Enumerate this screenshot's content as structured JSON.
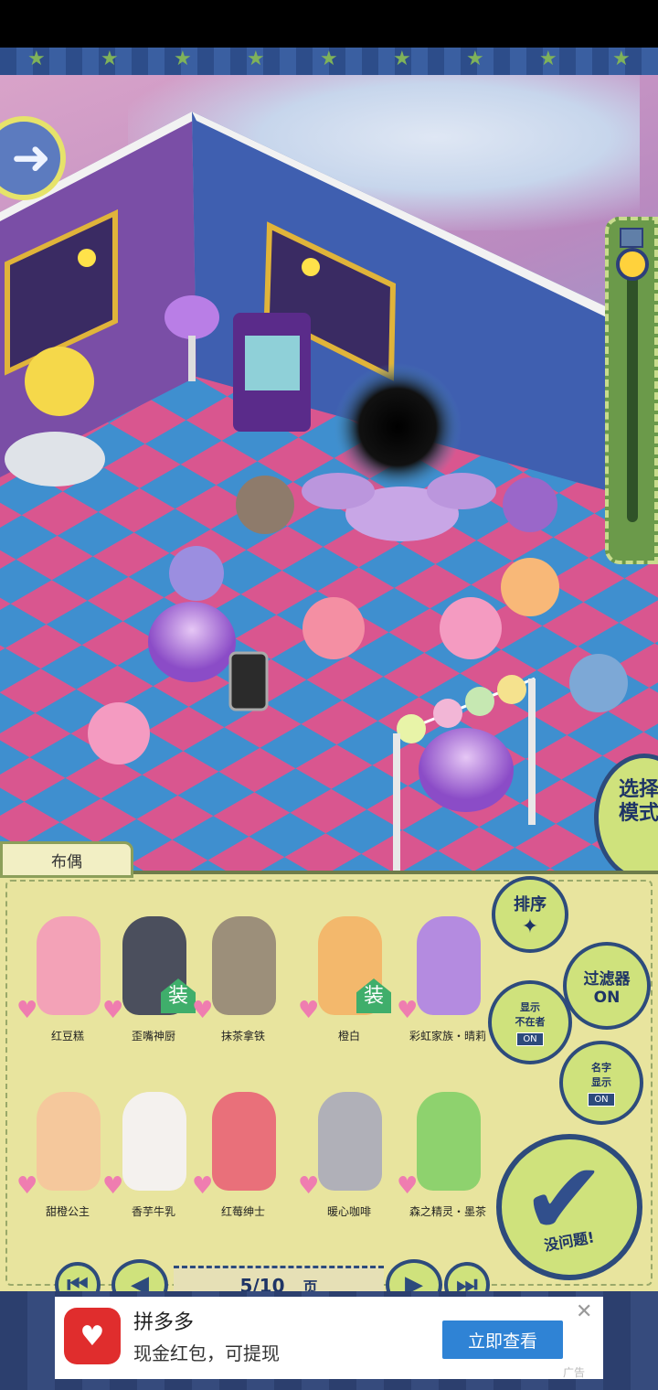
{
  "scene": {
    "panel_tab": "布偶",
    "select_mode": "选择模式"
  },
  "buttons": {
    "sort": "排序",
    "filter": "过滤器\nON",
    "show_absent": "显示\n不在者",
    "show_absent_state": "ON",
    "show_names": "名字\n显示",
    "show_names_state": "ON",
    "confirm": "没问题!"
  },
  "dolls": [
    {
      "name": "红豆糕",
      "color": "#f3a2b7",
      "tag": ""
    },
    {
      "name": "歪嘴神厨",
      "color": "#4b4f5d",
      "tag": "装"
    },
    {
      "name": "抹茶拿铁",
      "color": "#9c8f7a",
      "tag": ""
    },
    {
      "name": "橙白",
      "color": "#f3b86c",
      "tag": "装"
    },
    {
      "name": "彩虹家族・晴莉",
      "color": "#b48be0",
      "tag": ""
    },
    {
      "name": "甜橙公主",
      "color": "#f5c89c",
      "tag": ""
    },
    {
      "name": "香芋牛乳",
      "color": "#f4f1ee",
      "tag": ""
    },
    {
      "name": "红莓绅士",
      "color": "#e9707a",
      "tag": ""
    },
    {
      "name": "暖心咖啡",
      "color": "#b0b0b8",
      "tag": ""
    },
    {
      "name": "森之精灵・墨茶",
      "color": "#8ed26e",
      "tag": ""
    }
  ],
  "pager": {
    "page": "5/10",
    "unit": "页"
  },
  "ad": {
    "title": "拼多多",
    "subtitle": "现金红包，可提现",
    "cta": "立即查看",
    "label": "广告",
    "brand_color": "#e02d2d"
  }
}
